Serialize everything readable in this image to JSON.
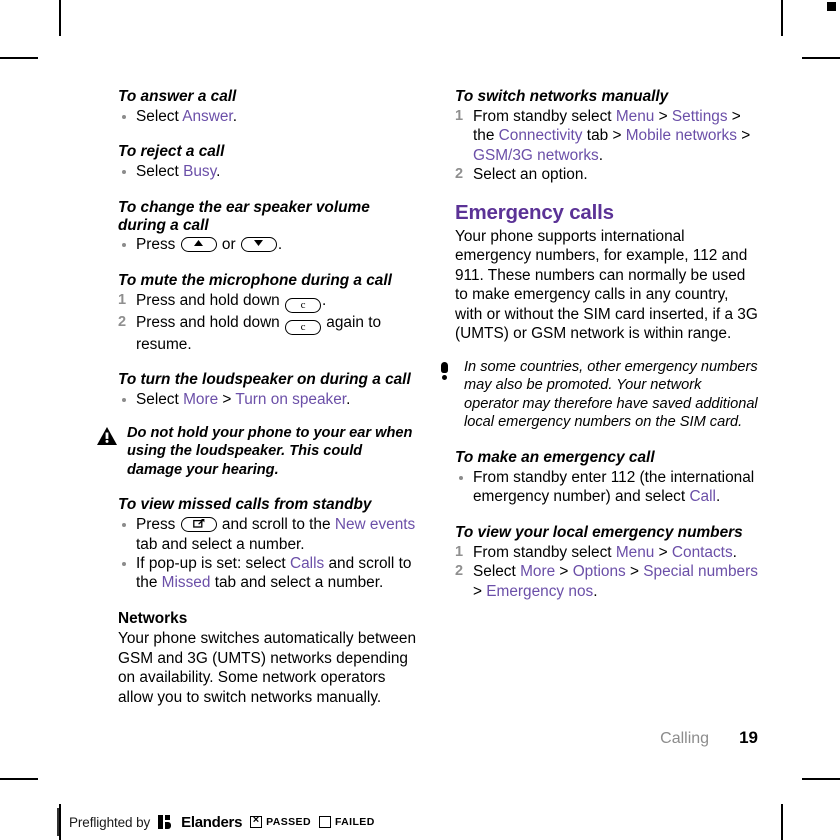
{
  "document": {
    "chapter_footer": "Calling",
    "page_number": "19"
  },
  "left_column": {
    "sections": [
      {
        "heading": "To answer a call",
        "bullets_prefix": "Select ",
        "link": "Answer",
        "suffix": "."
      },
      {
        "heading": "To reject a call",
        "bullets_prefix": "Select ",
        "link": "Busy",
        "suffix": "."
      }
    ],
    "answer_call": {
      "heading": "To answer a call",
      "bullet_pre": "Select ",
      "bullet_link": "Answer",
      "bullet_post": "."
    },
    "reject_call": {
      "heading": "To reject a call",
      "bullet_pre": "Select ",
      "bullet_link": "Busy",
      "bullet_post": "."
    },
    "ear_volume": {
      "heading": "To change the ear speaker volume during a call",
      "bullet_pre": "Press ",
      "key_up": "volume-up-key",
      "bullet_mid": " or ",
      "key_down": "volume-down-key",
      "bullet_post": "."
    },
    "mute_mic": {
      "heading": "To mute the microphone during a call",
      "step1_pre": "Press and hold down ",
      "step1_key": "c-key",
      "step1_post": ".",
      "step2_pre": "Press and hold down ",
      "step2_key": "c-key",
      "step2_post": " again to resume."
    },
    "loudspeaker": {
      "heading": "To turn the loudspeaker on during a call",
      "bullet_pre": "Select ",
      "link1": "More",
      "sep": " > ",
      "link2": "Turn on speaker",
      "bullet_post": "."
    },
    "warning": {
      "icon": "warning-triangle-icon",
      "text": "Do not hold your phone to your ear when using the loudspeaker. This could damage your hearing."
    },
    "missed_calls": {
      "heading": "To view missed calls from standby",
      "b1_pre": "Press ",
      "b1_key": "activity-menu-key",
      "b1_mid": " and scroll to the ",
      "b1_link": "New events",
      "b1_post": " tab and select a number.",
      "b2_pre": "If pop-up is set: select ",
      "b2_link1": "Calls",
      "b2_mid": " and scroll to the ",
      "b2_link2": "Missed",
      "b2_post": " tab and select a number."
    },
    "networks": {
      "heading": "Networks",
      "body": "Your phone switches automatically between GSM and 3G (UMTS) networks depending on availability. Some network operators allow you to switch networks manually."
    }
  },
  "right_column": {
    "switch_networks": {
      "heading": "To switch networks manually",
      "step1_pre": "From standby select ",
      "step1_link1": "Menu",
      "step1_s1": " > ",
      "step1_link2": "Settings",
      "step1_s2": " > the ",
      "step1_link3": "Connectivity",
      "step1_s3": " tab > ",
      "step1_link4": "Mobile networks",
      "step1_s4": " > ",
      "step1_link5": "GSM/3G networks",
      "step1_post": ".",
      "step2": "Select an option."
    },
    "emergency_calls": {
      "heading": "Emergency calls",
      "body": "Your phone supports international emergency numbers, for example, 112 and 911. These numbers can normally be used to make emergency calls in any country, with or without the SIM card inserted, if a 3G (UMTS) or GSM network is within range."
    },
    "note": {
      "icon": "exclamation-note-icon",
      "text": "In some countries, other emergency numbers may also be promoted. Your network operator may therefore have saved additional local emergency numbers on the SIM card."
    },
    "make_emergency_call": {
      "heading": "To make an emergency call",
      "bullet_pre": "From standby enter 112 (the international emergency number) and select ",
      "bullet_link": "Call",
      "bullet_post": "."
    },
    "local_emergency_numbers": {
      "heading": "To view your local emergency numbers",
      "step1_pre": "From standby select ",
      "step1_link1": "Menu",
      "step1_s1": " > ",
      "step1_link2": "Contacts",
      "step1_post": ".",
      "step2_pre": "Select ",
      "step2_link1": "More",
      "step2_s1": " > ",
      "step2_link2": "Options",
      "step2_s2": " > ",
      "step2_link3": "Special numbers",
      "step2_s3": " > ",
      "step2_link4": "Emergency nos",
      "step2_post": "."
    }
  },
  "preflight": {
    "label": "Preflighted by",
    "brand": "Elanders",
    "passed_label": "PASSED",
    "failed_label": "FAILED",
    "passed_checked": true
  },
  "colors": {
    "heading_purple": "#5B3296",
    "link_purple": "#6B4FA8",
    "footer_gray": "#8c8c8c",
    "bullet_gray": "#8f8f8f"
  }
}
